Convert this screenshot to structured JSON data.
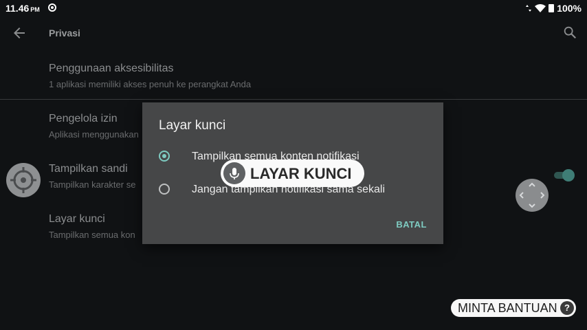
{
  "status_bar": {
    "time": "11.46",
    "ampm": "PM",
    "battery": "100%"
  },
  "toolbar": {
    "title": "Privasi",
    "back_icon": "arrow-back-icon",
    "search_icon": "search-icon"
  },
  "settings": [
    {
      "title": "Penggunaan aksesibilitas",
      "subtitle": "1 aplikasi memiliki akses penuh ke perangkat Anda"
    },
    {
      "title": "Pengelola izin",
      "subtitle": "Aplikasi menggunakan"
    },
    {
      "title": "Tampilkan sandi",
      "subtitle": "Tampilkan karakter se"
    },
    {
      "title": "Layar kunci",
      "subtitle": "Tampilkan semua kon"
    }
  ],
  "dialog": {
    "title": "Layar kunci",
    "options": [
      {
        "label": "Tampilkan semua konten notifikasi",
        "checked": true
      },
      {
        "label": "Jangan tampilkan notifikasi sama sekali",
        "checked": false
      }
    ],
    "cancel_label": "BATAL"
  },
  "voice_overlay": {
    "text": "LAYAR KUNCI",
    "icon": "microphone-icon"
  },
  "help_button": {
    "label": "MINTA BANTUAN",
    "icon_text": "?"
  },
  "colors": {
    "background": "#101214",
    "dialog": "#464748",
    "accent": "#7ecbc1"
  }
}
